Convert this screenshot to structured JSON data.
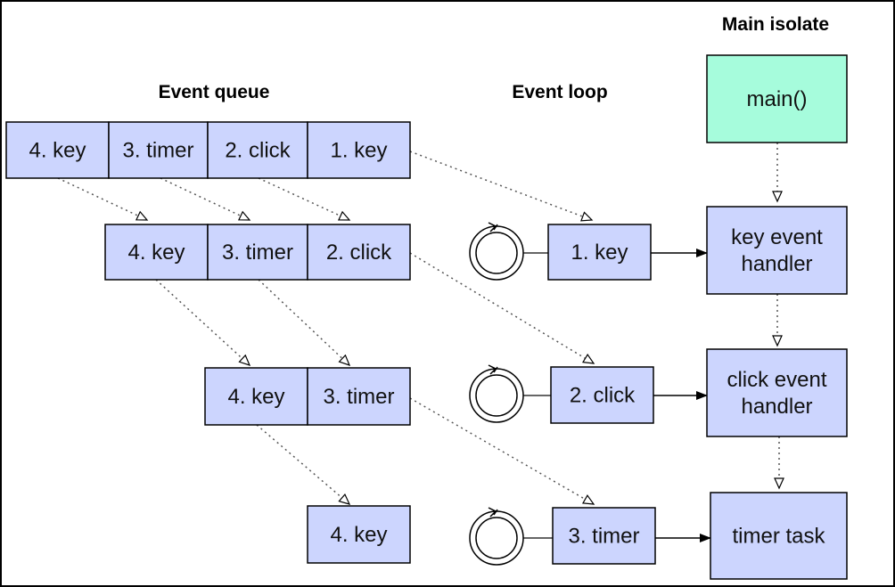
{
  "titles": {
    "main_isolate": "Main isolate",
    "event_queue": "Event queue",
    "event_loop": "Event loop"
  },
  "queue_rows": [
    [
      "4. key",
      "3. timer",
      "2. click",
      "1. key"
    ],
    [
      "4. key",
      "3. timer",
      "2. click"
    ],
    [
      "4. key",
      "3. timer"
    ],
    [
      "4. key"
    ]
  ],
  "loop_items": [
    "1. key",
    "2. click",
    "3. timer"
  ],
  "isolate": {
    "main": "main()",
    "handlers": [
      [
        "key event",
        "handler"
      ],
      [
        "click event",
        "handler"
      ],
      [
        "timer task"
      ]
    ]
  },
  "colors": {
    "box_fill": "#ccd5fe",
    "main_fill": "#a6fcdc",
    "stroke": "#000000"
  }
}
